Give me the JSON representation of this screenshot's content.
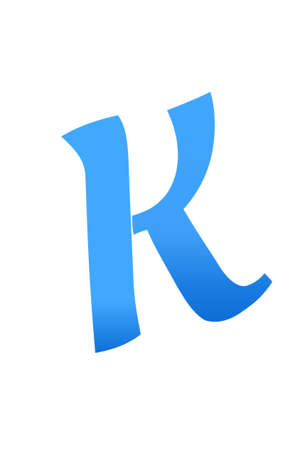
{
  "logo": {
    "letter": "K",
    "colors": {
      "light": "#41A8FE",
      "dark": "#0D6FD6",
      "background": "#FFFFFF"
    }
  }
}
